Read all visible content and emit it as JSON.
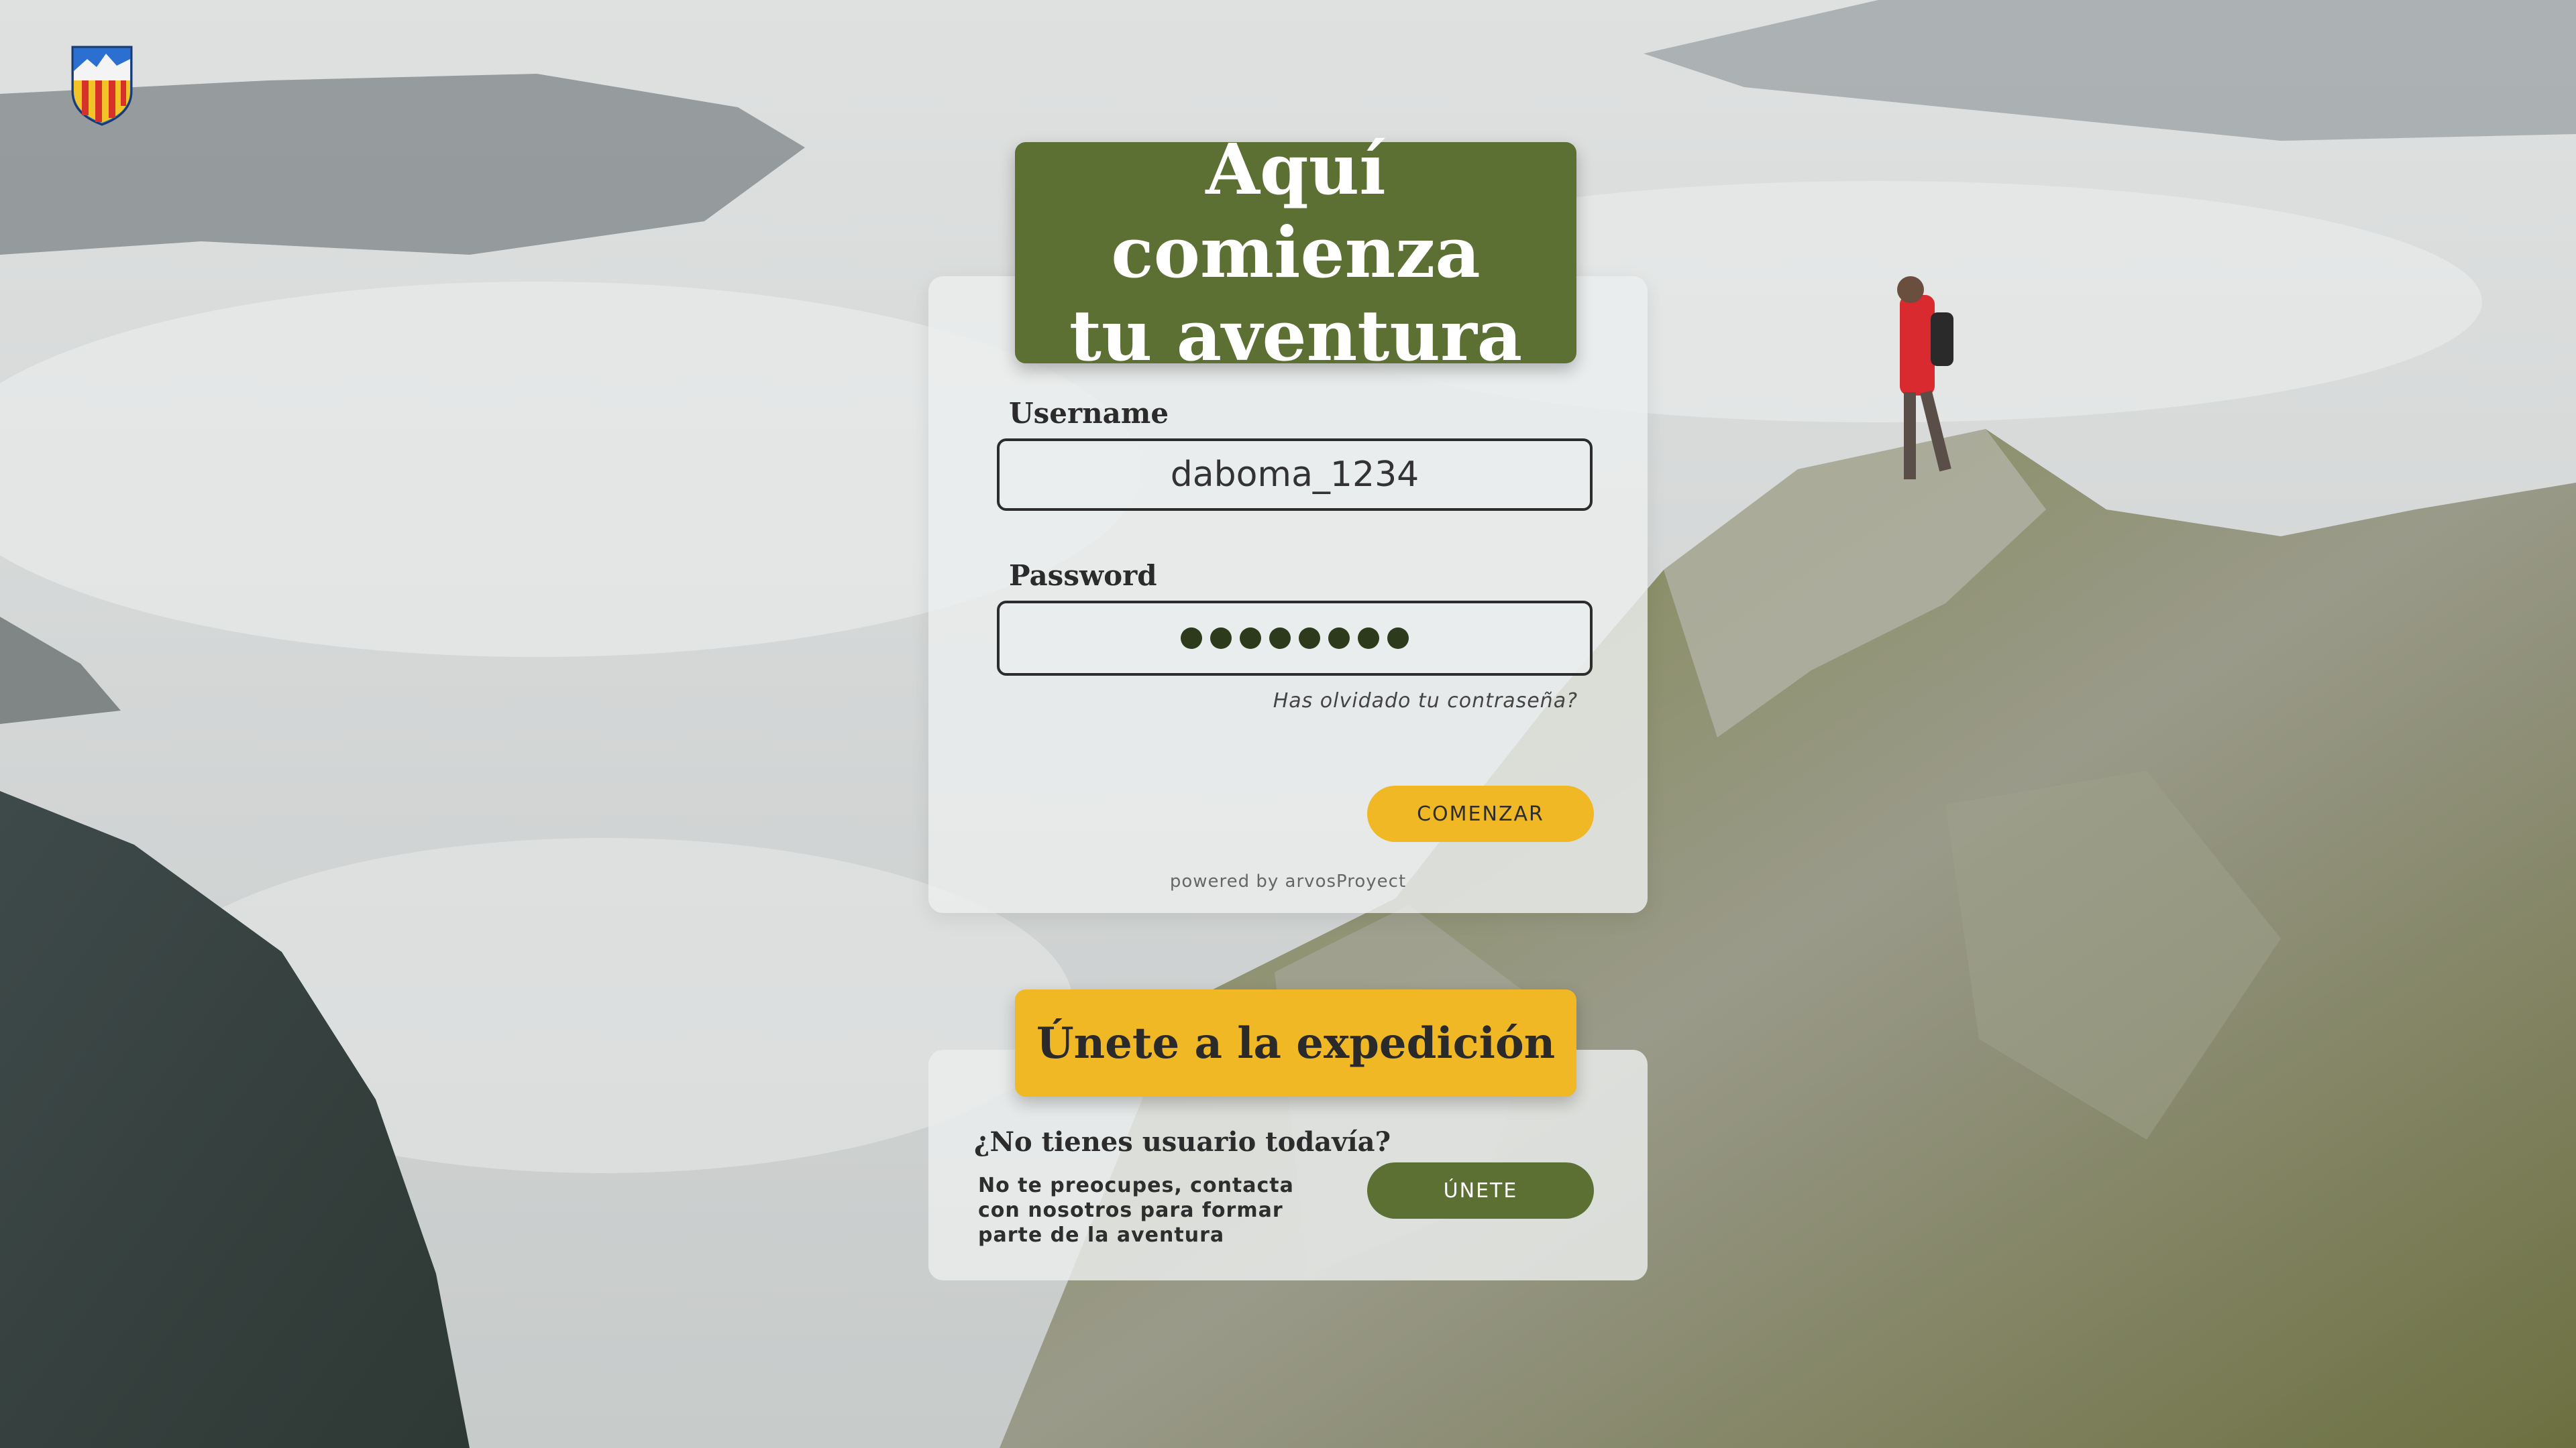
{
  "login": {
    "title": "Aquí comienza\ntu aventura",
    "username_label": "Username",
    "username_value": "daboma_1234",
    "password_label": "Password",
    "password_mask": "●●●●●●●●",
    "forgot_link": "Has olvidado tu contraseña?",
    "submit_label": "COMENZAR",
    "powered_by": "powered by arvosProyect"
  },
  "signup": {
    "title": "Únete a la expedición",
    "question": "¿No tienes usuario todavía?",
    "description": "No te preocupes, contacta con nosotros para formar parte de la aventura",
    "button_label": "ÚNETE"
  },
  "icons": {
    "logo": "mountain-crest-logo"
  },
  "colors": {
    "primary_green": "#5d7034",
    "accent_yellow": "#f0b825",
    "card_bg": "#ebeeee",
    "text_dark": "#2c2c2c"
  }
}
